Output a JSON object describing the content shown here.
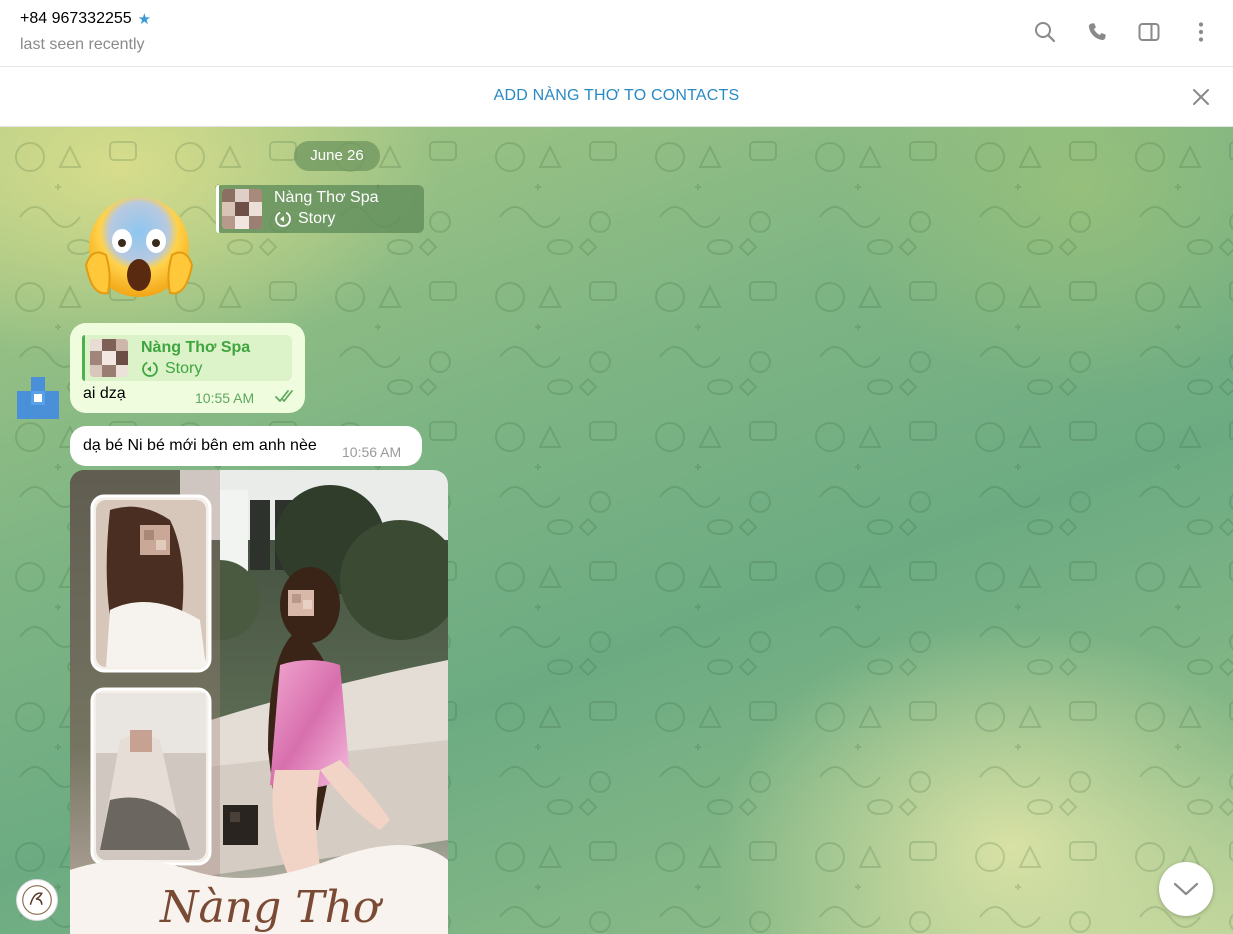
{
  "header": {
    "peer_name": "+84 967332255",
    "status": "last seen recently",
    "verified_icon": "star-icon"
  },
  "add_contact_bar": {
    "label": "ADD NÀNG THƠ TO CONTACTS"
  },
  "chat": {
    "date_separator": "June 26",
    "floating_reply": {
      "name": "Nàng Thơ Spa",
      "type": "Story"
    },
    "outgoing_message": {
      "reply_name": "Nàng Thơ Spa",
      "reply_type": "Story",
      "text": "ai dzạ",
      "time": "10:55 AM",
      "status": "read"
    },
    "incoming_message": {
      "text": "dạ bé Ni bé mới bên em anh nèe",
      "time": "10:56 AM"
    },
    "photo_caption": "Nàng Thơ"
  },
  "colors": {
    "accent": "#2a8ac4",
    "outgoing_bubble": "#effdde",
    "outgoing_accent": "#4fae4e"
  }
}
